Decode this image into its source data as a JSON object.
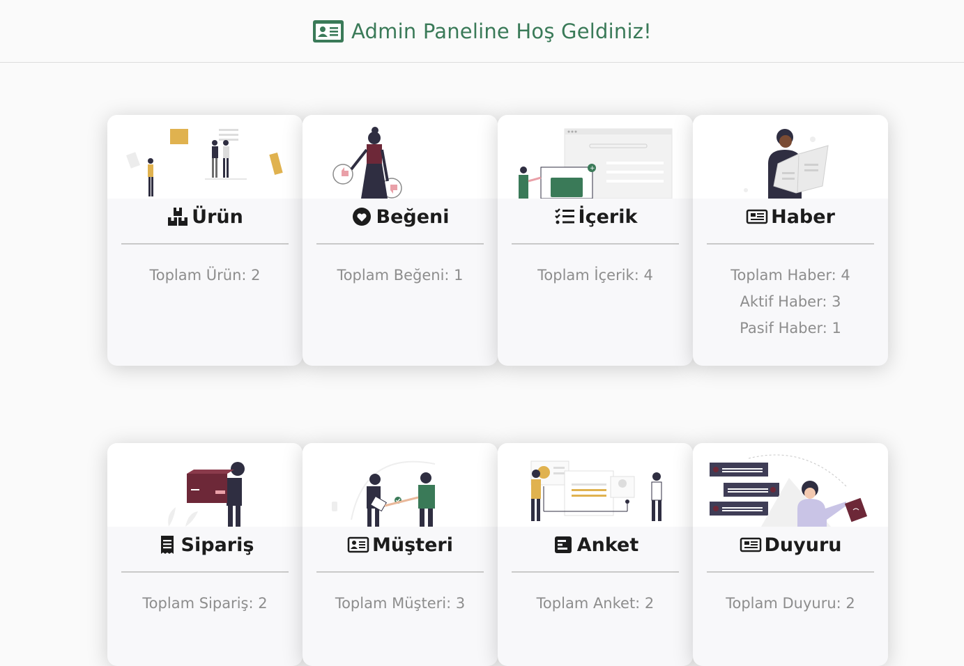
{
  "header": {
    "title": "Admin Paneline Hoş Geldiniz!",
    "icon": "id-card-icon",
    "color": "#3a7a58"
  },
  "cards": [
    {
      "title": "Ürün",
      "icon": "boxes-icon",
      "stats": [
        "Toplam Ürün: 2"
      ]
    },
    {
      "title": "Beğeni",
      "icon": "heart-circle-icon",
      "stats": [
        "Toplam Beğeni: 1"
      ]
    },
    {
      "title": "İçerik",
      "icon": "checklist-icon",
      "stats": [
        "Toplam İçerik: 4"
      ]
    },
    {
      "title": "Haber",
      "icon": "newspaper-icon",
      "stats": [
        "Toplam Haber: 4",
        "Aktif Haber: 3",
        "Pasif Haber: 1"
      ]
    },
    {
      "title": "Sipariş",
      "icon": "receipt-icon",
      "stats": [
        "Toplam Sipariş: 2"
      ]
    },
    {
      "title": "Müşteri",
      "icon": "id-card-icon",
      "stats": [
        "Toplam Müşteri: 3"
      ]
    },
    {
      "title": "Anket",
      "icon": "poll-icon",
      "stats": [
        "Toplam Anket: 2"
      ]
    },
    {
      "title": "Duyuru",
      "icon": "newspaper-icon",
      "stats": [
        "Toplam Duyuru: 2"
      ]
    }
  ],
  "colors": {
    "accent": "#3a7a58",
    "maroon": "#6d2838",
    "gold": "#e0b24f",
    "dark": "#2f2e41"
  }
}
